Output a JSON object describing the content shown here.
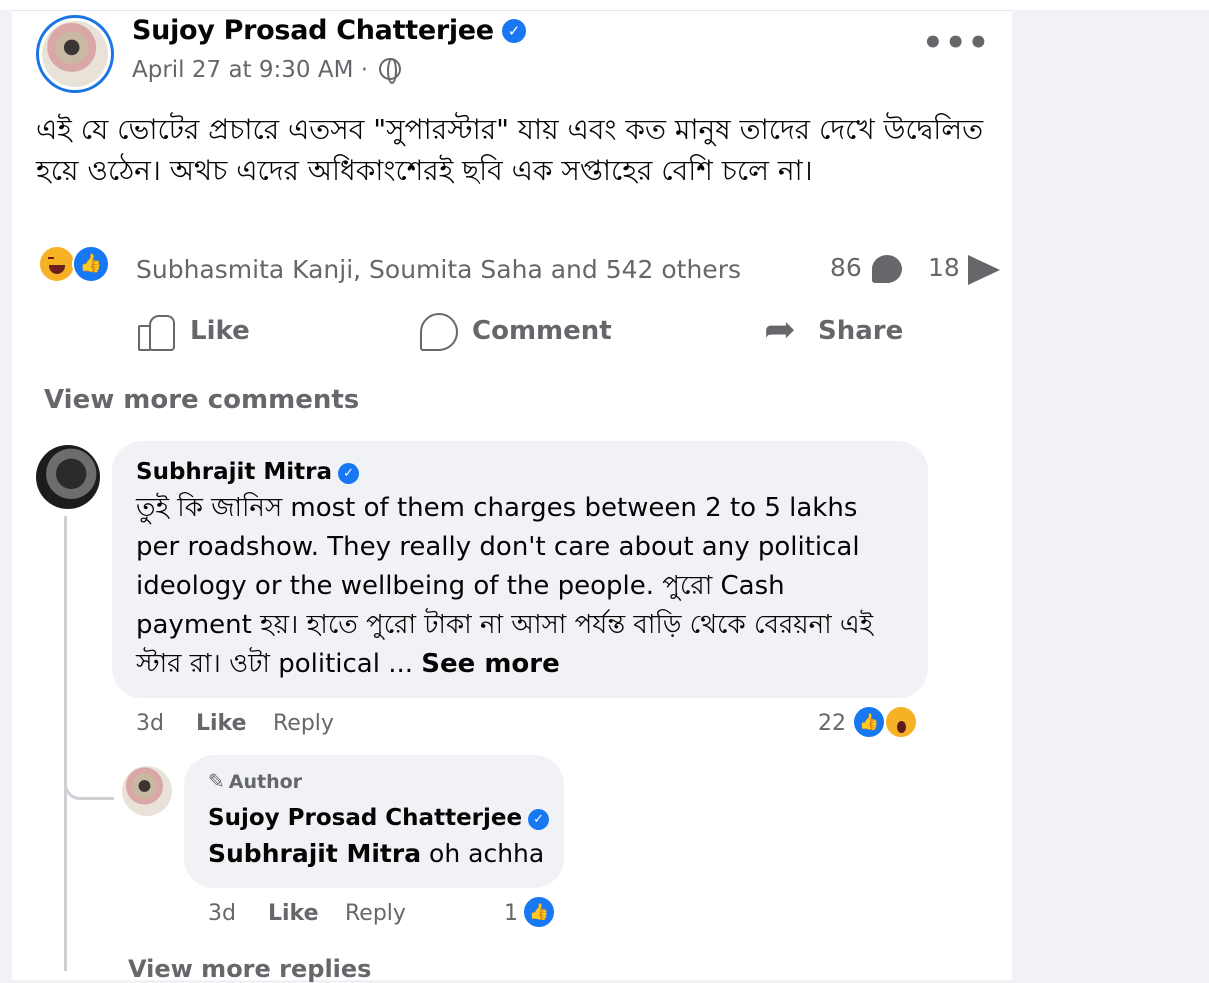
{
  "post": {
    "author": "Sujoy Prosad Chatterjee",
    "timestamp": "April 27 at 9:30 AM",
    "separator": "·",
    "audience_icon": "globe-icon",
    "body": "এই যে ভোটের প্রচারে এতসব \"সুপারস্টার\" যায় এবং কত মানুষ তাদের দেখে উদ্বেলিত হয়ে ওঠেন। অথচ এদের অধিকাংশেরই ছবি এক সপ্তাহের বেশি চলে না।",
    "reactions_summary": "Subhasmita Kanji, Soumita Saha and 542 others",
    "comment_count": "86",
    "share_count": "18"
  },
  "actions": {
    "like": "Like",
    "comment": "Comment",
    "share": "Share"
  },
  "view_more_comments": "View more comments",
  "comments": [
    {
      "author": "Subhrajit Mitra",
      "text": "তুই কি জানিস most of them charges between 2 to 5 lakhs per roadshow. They really don't care about any political ideology or the wellbeing of the people. পুরো Cash payment হয়। হাতে পুরো টাকা না আসা পর্যন্ত বাড়ি থেকে বেরয়না এই স্টার রা। ওটা political ...",
      "see_more": "See more",
      "age": "3d",
      "like": "Like",
      "reply": "Reply",
      "reaction_count": "22"
    },
    {
      "badge": "Author",
      "author": "Sujoy Prosad Chatterjee",
      "mention": "Subhrajit Mitra",
      "text": "oh achha",
      "age": "3d",
      "like": "Like",
      "reply": "Reply",
      "reaction_count": "1"
    }
  ],
  "view_replies": "View more replies",
  "colors": {
    "accent": "#1877f2",
    "secondary_text": "#65676b",
    "bubble": "#f0f2f5"
  }
}
